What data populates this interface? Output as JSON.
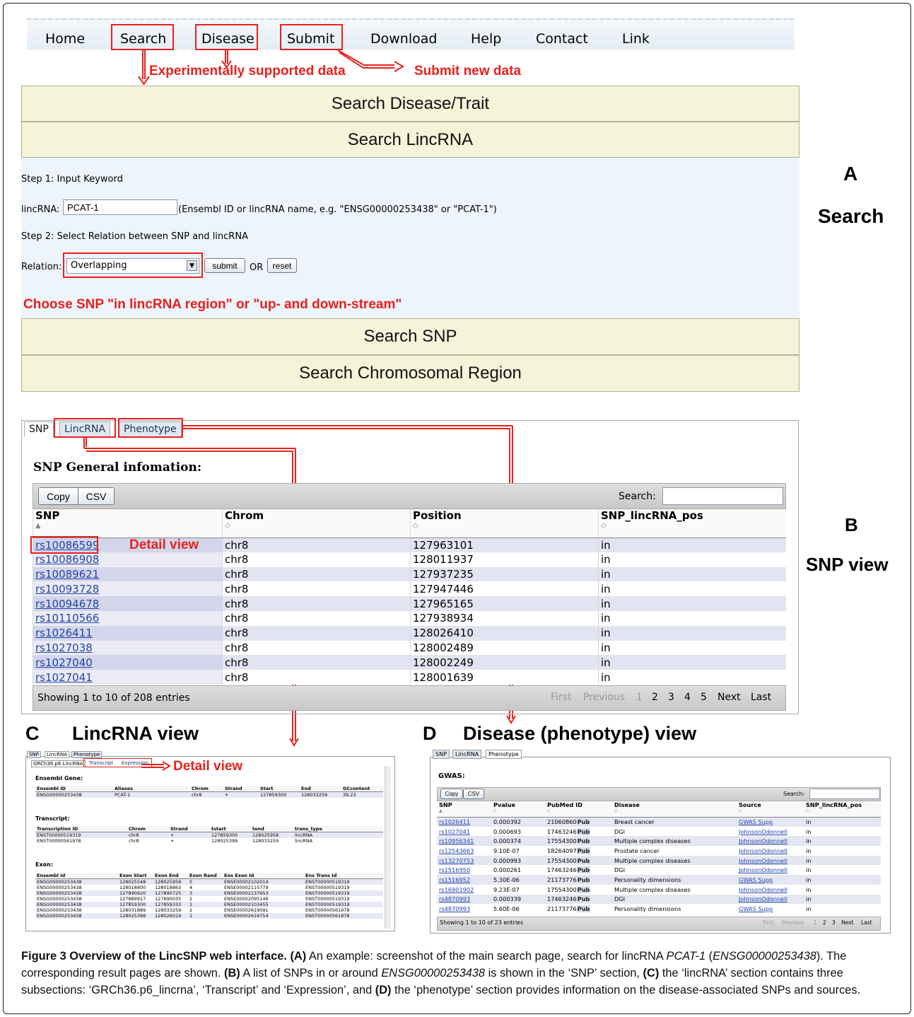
{
  "nav": {
    "items": [
      "Home",
      "Search",
      "Disease",
      "Submit",
      "Download",
      "Help",
      "Contact",
      "Link"
    ]
  },
  "annotations": {
    "experimental": "Experimentally supported data",
    "submit_new": "Submit new data",
    "choose_snp": "Choose SNP \"in lincRNA region\" or \"up- and down-stream\"",
    "detail_view": "Detail view",
    "detail_view_c": "Detail view"
  },
  "search": {
    "bar_disease": "Search Disease/Trait",
    "bar_lincrna": "Search LincRNA",
    "bar_snp": "Search SNP",
    "bar_region": "Search Chromosomal Region",
    "step1": "Step 1: Input Keyword",
    "lincrna_label": "lincRNA:",
    "lincrna_value": "PCAT-1",
    "lincrna_hint": "(Ensembl ID or lincRNA name, e.g. \"ENSG00000253438\" or \"PCAT-1\")",
    "step2": "Step 2: Select Relation between SNP and lincRNA",
    "relation_label": "Relation:",
    "relation_value": "Overlapping",
    "submit_btn": "submit",
    "or_text": "OR",
    "reset_btn": "reset"
  },
  "side_labels": {
    "a_letter": "A",
    "a_title": "Search",
    "b_letter": "B",
    "b_title": "SNP view"
  },
  "snp_view": {
    "tabs": [
      "SNP",
      "LincRNA",
      "Phenotype"
    ],
    "heading": "SNP General infomation:",
    "copy": "Copy",
    "csv": "CSV",
    "search_label": "Search:",
    "columns": [
      "SNP",
      "Chrom",
      "Position",
      "SNP_lincRNA_pos"
    ],
    "rows": [
      [
        "rs10086599",
        "chr8",
        "127963101",
        "in"
      ],
      [
        "rs10086908",
        "chr8",
        "128011937",
        "in"
      ],
      [
        "rs10089621",
        "chr8",
        "127937235",
        "in"
      ],
      [
        "rs10093728",
        "chr8",
        "127947446",
        "in"
      ],
      [
        "rs10094678",
        "chr8",
        "127965165",
        "in"
      ],
      [
        "rs10110566",
        "chr8",
        "127938934",
        "in"
      ],
      [
        "rs1026411",
        "chr8",
        "128026410",
        "in"
      ],
      [
        "rs1027038",
        "chr8",
        "128002489",
        "in"
      ],
      [
        "rs1027040",
        "chr8",
        "128002249",
        "in"
      ],
      [
        "rs1027041",
        "chr8",
        "128001639",
        "in"
      ]
    ],
    "showing": "Showing 1 to 10 of 208 entries",
    "pager": [
      "First",
      "Previous",
      "1",
      "2",
      "3",
      "4",
      "5",
      "Next",
      "Last"
    ]
  },
  "lincrna_view": {
    "letter": "C",
    "title": "LincRNA view",
    "tabs": [
      "SNP",
      "LincRNA",
      "Phenotype"
    ],
    "subtabs": [
      "GRCh36.p6 LincRNA",
      "Transcript",
      "Expression"
    ],
    "gene_heading": "Ensembl Gene:",
    "gene_cols": [
      "Ensembl ID",
      "Aliases",
      "Chrom",
      "Strand",
      "Start",
      "End",
      "GCcontent"
    ],
    "gene_rows": [
      [
        "ENSG00000253438",
        "PCAT-1",
        "chr8",
        "+",
        "127859300",
        "128033259",
        "39.23"
      ]
    ],
    "transcript_heading": "Transcript:",
    "transcript_cols": [
      "Transcription ID",
      "Chrom",
      "Strand",
      "tstart",
      "tend",
      "trans_type"
    ],
    "transcript_rows": [
      [
        "ENST00000519319",
        "chr8",
        "+",
        "127859300",
        "128025958",
        "lincRNA"
      ],
      [
        "ENST00000561978",
        "chr8",
        "+",
        "128025399",
        "128033259",
        "lincRNA"
      ]
    ],
    "exon_heading": "Exon:",
    "exon_cols": [
      "Ensembl Id",
      "Exon Start",
      "Exon End",
      "Exon Rand",
      "Ens Exon Id",
      "Ens Trans Id"
    ],
    "exon_rows": [
      [
        "ENSG00000253438",
        "128025548",
        "128025958",
        "5",
        "ENSE00002102014",
        "ENST00000519319"
      ],
      [
        "ENSG00000253438",
        "128018800",
        "128018863",
        "4",
        "ENSE00002115779",
        "ENST00000519319"
      ],
      [
        "ENSG00000253438",
        "127890620",
        "127890725",
        "3",
        "ENSE00002137653",
        "ENST00000519319"
      ],
      [
        "ENSG00000253438",
        "127889917",
        "127890035",
        "2",
        "ENSE00002095146",
        "ENST00000519319"
      ],
      [
        "ENSG00000253438",
        "127859300",
        "127859333",
        "1",
        "ENSE00002103455",
        "ENST00000519319"
      ],
      [
        "ENSG00000253438",
        "128031889",
        "128033259",
        "2",
        "ENSE00002619091",
        "ENST00000561978"
      ],
      [
        "ENSG00000253438",
        "128025399",
        "128026019",
        "1",
        "ENSE00002616754",
        "ENST00000561978"
      ]
    ]
  },
  "disease_view": {
    "letter": "D",
    "title": "Disease (phenotype) view",
    "tabs": [
      "SNP",
      "LincRNA",
      "Phenotype"
    ],
    "heading": "GWAS:",
    "copy": "Copy",
    "csv": "CSV",
    "search_label": "Search:",
    "columns": [
      "SNP",
      "Pvalue",
      "PubMed ID",
      "Disease",
      "Source",
      "SNP_lincRNA_pos"
    ],
    "pub_label": "Pub",
    "rows": [
      [
        "rs1026411",
        "0.000392",
        "21060860",
        "Breast cancer",
        "GWAS Supp",
        "in"
      ],
      [
        "rs1027041",
        "0.000693",
        "17463246",
        "DGI",
        "JohnsonOdonnell",
        "in"
      ],
      [
        "rs10956341",
        "0.000374",
        "17554300",
        "Multiple complex diseases",
        "JohnsonOdonnell",
        "in"
      ],
      [
        "rs12543663",
        "9.10E-07",
        "18264097",
        "Prostate cancer",
        "JohnsonOdonnell",
        "in"
      ],
      [
        "rs13270753",
        "0.000993",
        "17554300",
        "Multiple complex diseases",
        "JohnsonOdonnell",
        "in"
      ],
      [
        "rs1516950",
        "0.000261",
        "17463246",
        "DGI",
        "JohnsonOdonnell",
        "in"
      ],
      [
        "rs1516952",
        "5.30E-06",
        "21173776",
        "Personality dimensions",
        "GWAS Supp",
        "in"
      ],
      [
        "rs16901902",
        "9.23E-07",
        "17554300",
        "Multiple complex diseases",
        "JohnsonOdonnell",
        "in"
      ],
      [
        "rs4870993",
        "0.000339",
        "17463246",
        "DGI",
        "JohnsonOdonnell",
        "in"
      ],
      [
        "rs4870993",
        "5.60E-06",
        "21173776",
        "Personality dimensions",
        "GWAS Supp",
        "in"
      ]
    ],
    "showing": "Showing 1 to 10 of 23 entries",
    "pager": [
      "First",
      "Previous",
      "1",
      "2",
      "3",
      "Next",
      "Last"
    ]
  },
  "caption": {
    "label": "Figure 3 Overview of the LincSNP web interface.",
    "a_tag": "(A)",
    "a_text": " An example: screenshot of the main search page, search for lincRNA ",
    "pcat": "PCAT-1",
    "paren_open": " (",
    "ensg": "ENSG00000253438",
    "paren_close": ").",
    "sent2": " The corresponding result pages are shown. ",
    "b_tag": "(B)",
    "b_text": " A list of SNPs in or around ",
    "ensg2": "ENSG00000253438",
    "b_text2": " is shown in the ‘SNP’ section, ",
    "c_tag": "(C)",
    "c_text": " the ‘lincRNA’ section contains three subsections: ‘GRCh36.p6_lincrna’, ‘Transcript’ and ‘Expression’, and ",
    "d_tag": "(D)",
    "d_text": " the ‘phenotype’ section provides information on the disease-associated SNPs and sources."
  }
}
